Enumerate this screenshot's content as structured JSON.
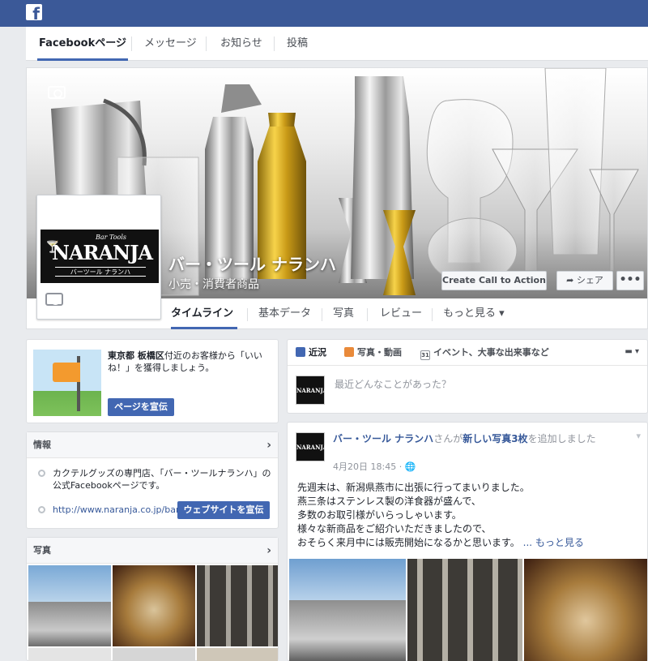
{
  "app": {
    "logo_glyph": "f",
    "brand_color": "#3b5998",
    "accent_color": "#4267b2"
  },
  "top_tabs": [
    {
      "label": "Facebookページ",
      "active": true
    },
    {
      "label": "メッセージ"
    },
    {
      "label": "お知らせ"
    },
    {
      "label": "投稿"
    }
  ],
  "page": {
    "name": "バー・ツール ナランハ",
    "category": "小売・消費者商品",
    "logo": {
      "small_text": "Bar Tools",
      "name": "NARANJA",
      "jp_text": "バーツール ナランハ"
    },
    "cta_label": "Create Call to Action",
    "share_label": "シェア",
    "more_label": "•••"
  },
  "page_nav": [
    {
      "label": "タイムライン",
      "active": true
    },
    {
      "label": "基本データ"
    },
    {
      "label": "写真"
    },
    {
      "label": "レビュー"
    },
    {
      "label": "もっと見る ▾"
    }
  ],
  "promo": {
    "text_bold": "東京都 板橋区",
    "text_rest": "付近のお客様から「いいね！」を獲得しましょう。",
    "button": "ページを宣伝"
  },
  "info": {
    "header": "情報",
    "description": "カクテルグッズの専門店、「バー・ツールナランハ」の公式Facebookページです。",
    "url": "http://www.naranja.co.jp/bar",
    "website_button": "ウェブサイトを宣伝"
  },
  "photos": {
    "header": "写真"
  },
  "composer": {
    "tabs": [
      {
        "label": "近況",
        "icon": "pencil-icon",
        "color": "#4267b2"
      },
      {
        "label": "写真・動画",
        "icon": "photo-icon",
        "color": "#e98a3a"
      },
      {
        "label": "イベント、大事な出来事など",
        "icon": "calendar-icon",
        "calendar_day": "31"
      }
    ],
    "placeholder": "最近どんなことがあった？",
    "logo_text": "NARANJA"
  },
  "post": {
    "author": "バー・ツール ナランハ",
    "action_prefix": "さんが",
    "action_link": "新しい写真3枚",
    "action_suffix": "を追加しました",
    "date": "4月20日 18:45 · ",
    "globe": "🌐",
    "lines": [
      "先週末は、新潟県燕市に出張に行ってまいりました。",
      "燕三条はステンレス製の洋食器が盛んで、",
      "多数のお取引様がいらっしゃいます。",
      "様々な新商品をご紹介いただきましたので、",
      "おそらく来月中には販売開始になるかと思います。"
    ],
    "more_link": "... もっと見る"
  }
}
